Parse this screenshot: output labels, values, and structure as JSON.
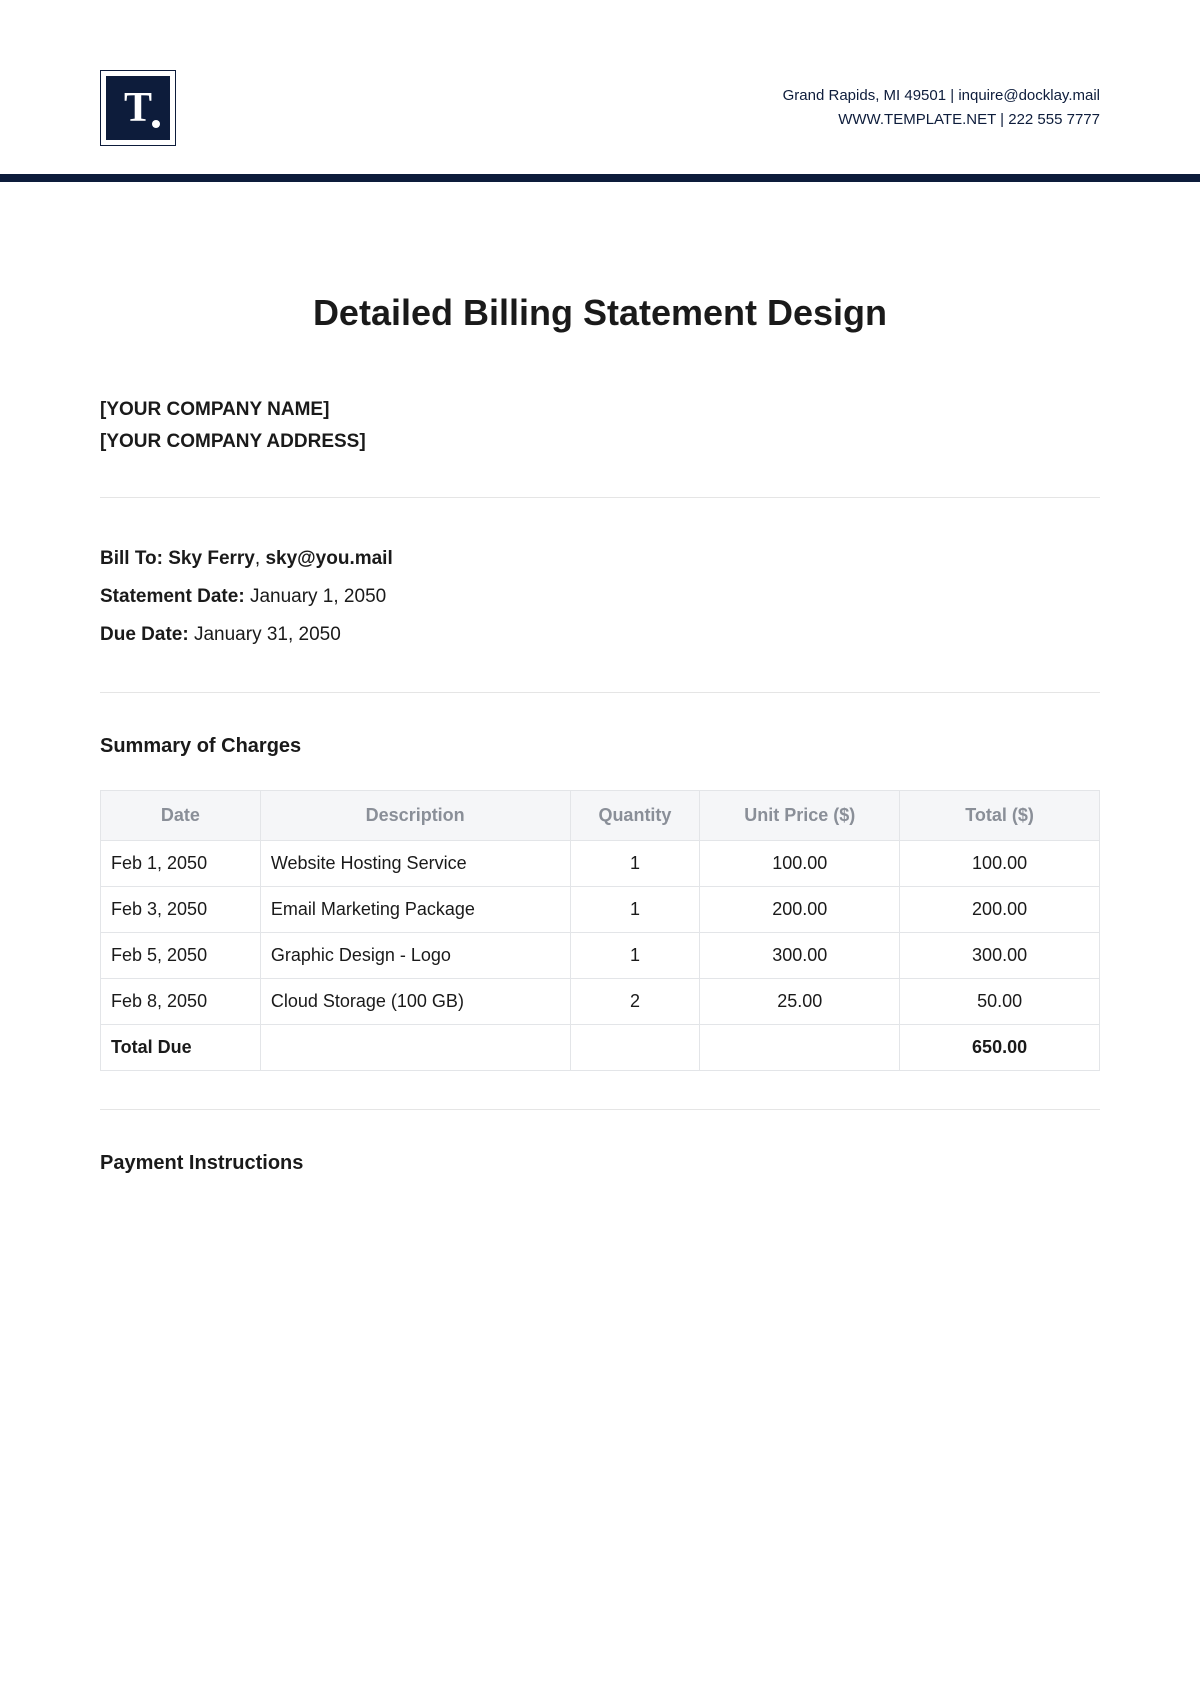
{
  "header": {
    "contact_line1_left": "Grand Rapids, MI 49501",
    "contact_line1_right": "inquire@docklay.mail",
    "contact_line2_left": "WWW.TEMPLATE.NET",
    "contact_line2_right": "222 555 7777",
    "separator": "  |  "
  },
  "title": "Detailed Billing Statement Design",
  "company": {
    "name": "[YOUR COMPANY NAME]",
    "address": "[YOUR COMPANY ADDRESS]"
  },
  "bill_to": {
    "label": "Bill To:",
    "name": "Sky Ferry",
    "email": "sky@you.mail"
  },
  "statement_date": {
    "label": "Statement Date:",
    "value": "January 1, 2050"
  },
  "due_date": {
    "label": "Due Date:",
    "value": "January 31, 2050"
  },
  "summary_heading": "Summary of Charges",
  "table": {
    "headers": {
      "date": "Date",
      "description": "Description",
      "quantity": "Quantity",
      "unit_price": "Unit Price ($)",
      "total": "Total ($)"
    },
    "rows": [
      {
        "date": "Feb 1, 2050",
        "description": "Website Hosting Service",
        "quantity": "1",
        "unit_price": "100.00",
        "total": "100.00"
      },
      {
        "date": "Feb 3, 2050",
        "description": "Email Marketing Package",
        "quantity": "1",
        "unit_price": "200.00",
        "total": "200.00"
      },
      {
        "date": "Feb 5, 2050",
        "description": "Graphic Design - Logo",
        "quantity": "1",
        "unit_price": "300.00",
        "total": "300.00"
      },
      {
        "date": "Feb 8, 2050",
        "description": "Cloud Storage (100 GB)",
        "quantity": "2",
        "unit_price": "25.00",
        "total": "50.00"
      }
    ],
    "total_due_label": "Total Due",
    "total_due_value": "650.00"
  },
  "payment_heading": "Payment Instructions"
}
